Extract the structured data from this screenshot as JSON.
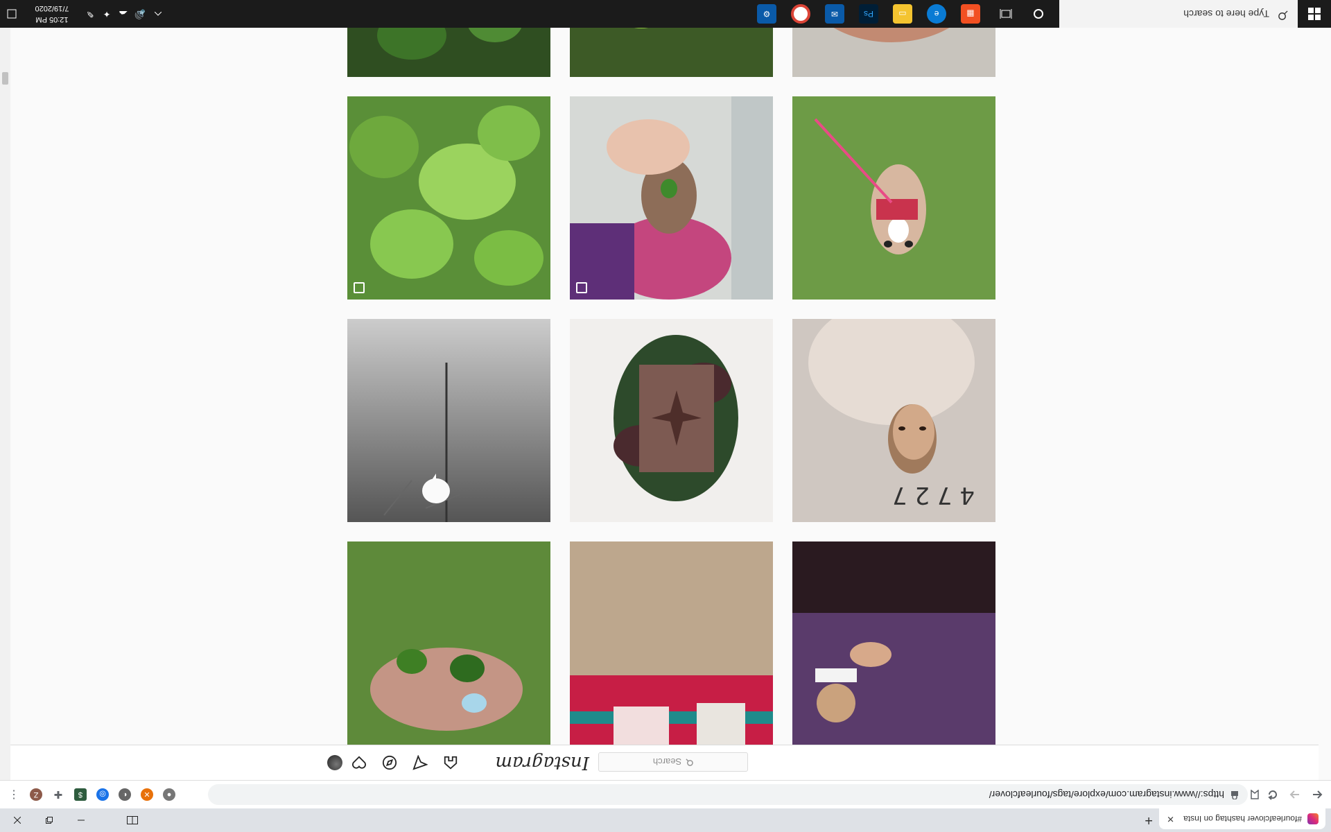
{
  "browser": {
    "tab_title": "#fourleafclover hashtag on Insta",
    "close_glyph": "✕",
    "new_tab_glyph": "+",
    "url": "https://www.instagram.com/explore/tags/fourleafclover/",
    "ext_avatar_letter": "Z"
  },
  "instagram": {
    "logo": "Instagram",
    "search_placeholder": "Search"
  },
  "taskbar": {
    "search_placeholder": "Type here to search",
    "time": "12:05 PM",
    "date": "7/19/2020"
  }
}
